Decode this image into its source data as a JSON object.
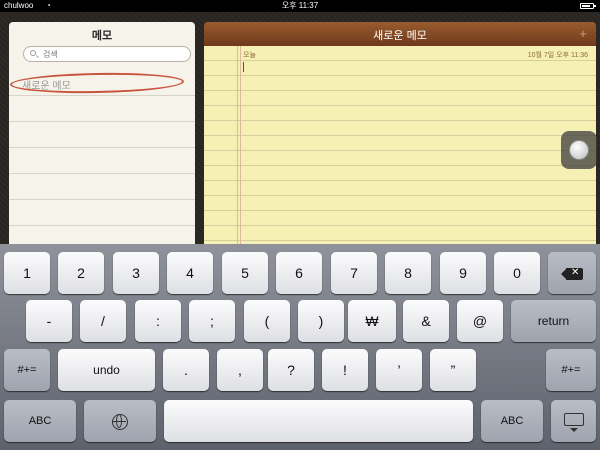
{
  "status_bar": {
    "carrier": "chulwoo",
    "time": "오후 11:37"
  },
  "memo_list": {
    "title": "메모",
    "search_placeholder": "검색",
    "items": [
      {
        "label": "새로운 메모"
      }
    ]
  },
  "note": {
    "title": "새로운 메모",
    "add_label": "+",
    "today_label": "오늘",
    "date_label": "10월 7일 오후 11:36"
  },
  "keyboard": {
    "row1": [
      "1",
      "2",
      "3",
      "4",
      "5",
      "6",
      "7",
      "8",
      "9",
      "0"
    ],
    "row2": [
      "-",
      "/",
      ":",
      ";",
      "(",
      ")",
      "₩",
      "&",
      "@"
    ],
    "return_label": "return",
    "row3_left": "#+=",
    "undo_label": "undo",
    "row3": [
      ".",
      ",",
      "?",
      "!",
      "’",
      "”"
    ],
    "row3_right": "#+=",
    "abc_label": "ABC",
    "abc_label_right": "ABC"
  },
  "colors": {
    "paper": "#f7f0b5",
    "header": "#7f4622",
    "highlight": "#c9553f"
  }
}
